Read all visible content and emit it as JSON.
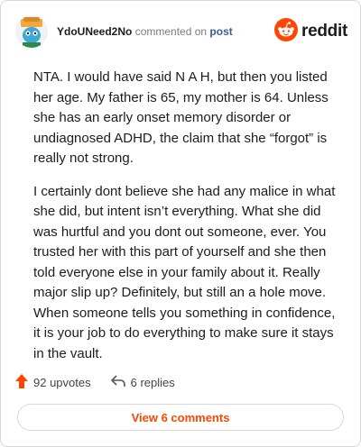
{
  "header": {
    "username": "YdoUNeed2No",
    "commented_text": "commented on",
    "post_link": "post",
    "brand_name": "reddit"
  },
  "comment": {
    "paragraphs": [
      "NTA. I would have said N A H, but then you listed her age. My father is 65, my mother is 64. Unless she has an early onset memory disorder or undiagnosed ADHD, the claim that she “forgot” is really not strong.",
      "I certainly dont believe she had any malice in what she did, but intent isn’t everything. What she did was hurtful and you dont out someone, ever. You trusted her with this part of yourself and she then told everyone else in your family about it. Really major slip up? Definitely, but still an a hole move. When someone tells you something in confidence, it is your job to do everything to make sure it stays in the vault."
    ]
  },
  "actions": {
    "upvotes": "92 upvotes",
    "replies": "6 replies",
    "upvote_icon": "upvote-arrow-icon",
    "reply_icon": "reply-arrow-icon"
  },
  "view_button": {
    "label": "View 6 comments"
  },
  "colors": {
    "accent": "#ff4500",
    "link": "#3b5b9a",
    "muted": "#7c7c7c",
    "border": "#d8d8d8"
  }
}
